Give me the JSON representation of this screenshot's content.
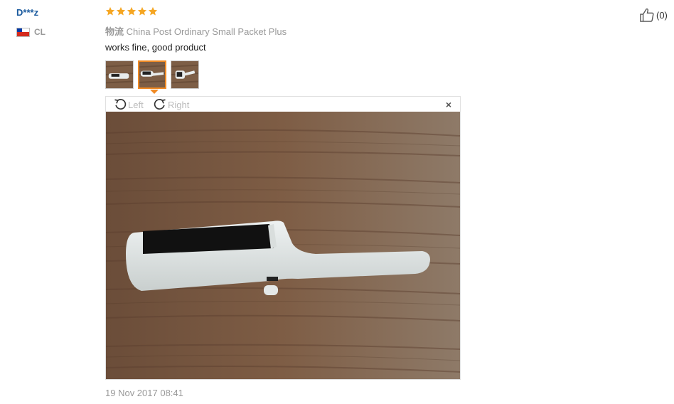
{
  "review": {
    "user": "D***z",
    "country_code": "CL",
    "rating": 5,
    "shipping_label": "物流",
    "shipping_method": "China Post Ordinary Small Packet Plus",
    "text": "works fine, good product",
    "date": "19 Nov 2017 08:41",
    "likes": "(0)"
  },
  "viewer": {
    "rotate_left": "Left",
    "rotate_right": "Right",
    "close": "×"
  },
  "thumbnails": [
    "photo-1",
    "photo-2",
    "photo-3"
  ],
  "colors": {
    "accent": "#f08a24",
    "star": "#f5a623",
    "link": "#1a5a9e",
    "muted": "#999999"
  }
}
